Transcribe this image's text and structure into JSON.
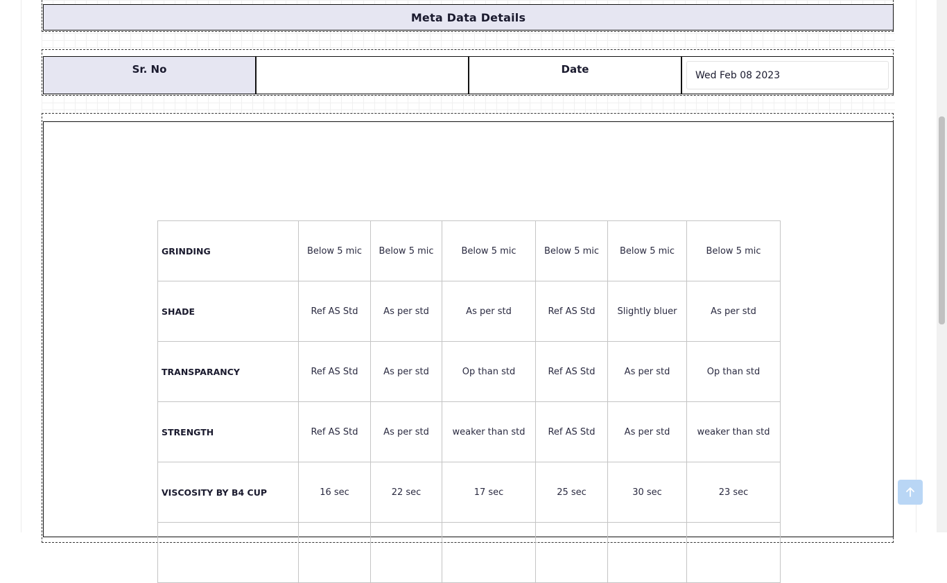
{
  "header": {
    "title": "Meta Data Details"
  },
  "meta": {
    "sr_no_label": "Sr. No",
    "sr_no_value": "",
    "date_label": "Date",
    "date_value": "Wed Feb 08 2023"
  },
  "results_table": {
    "rows": [
      {
        "param": "GRINDING",
        "values": [
          "Below 5 mic",
          "Below 5 mic",
          "Below 5 mic",
          "Below 5 mic",
          "Below 5 mic",
          "Below 5 mic"
        ]
      },
      {
        "param": "SHADE",
        "values": [
          "Ref AS Std",
          "As per std",
          "As per std",
          "Ref AS Std",
          "Slightly bluer",
          "As per std"
        ]
      },
      {
        "param": "TRANSPARANCY",
        "values": [
          "Ref AS Std",
          "As per std",
          "Op than std",
          "Ref AS Std",
          "As per std",
          "Op than std"
        ]
      },
      {
        "param": "STRENGTH",
        "values": [
          "Ref AS Std",
          "As per std",
          "weaker than std",
          "Ref AS Std",
          "As per std",
          "weaker than std"
        ]
      },
      {
        "param": "VISCOSITY BY B4 CUP",
        "values": [
          "16 sec",
          "22 sec",
          "17 sec",
          "25 sec",
          "30 sec",
          "23 sec"
        ]
      },
      {
        "param": "",
        "values": [
          "",
          "",
          "",
          "",
          "",
          ""
        ]
      }
    ]
  },
  "icons": {
    "back_to_top": "arrow-up-icon"
  },
  "colors": {
    "header_bg": "#e6e6f2",
    "back_to_top_bg": "#b9d6f5"
  }
}
